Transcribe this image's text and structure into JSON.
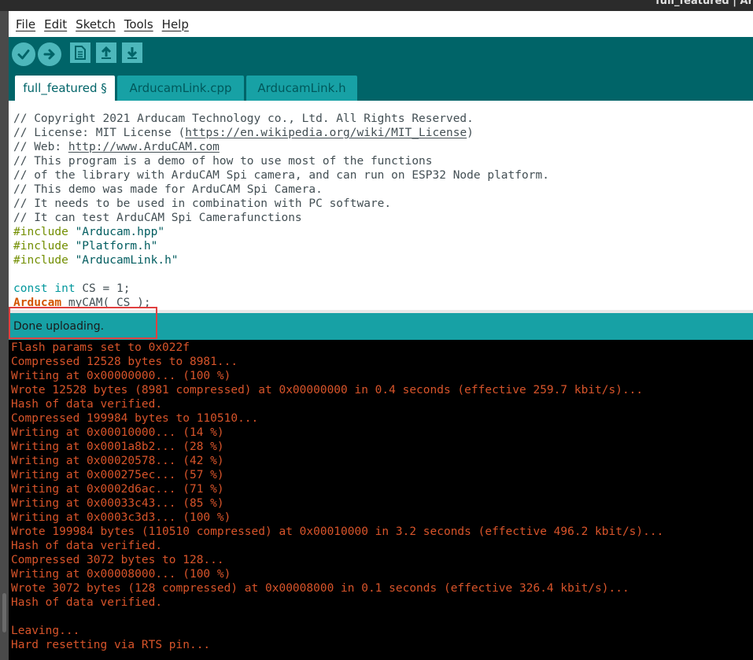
{
  "window": {
    "title": "full_featured | Ar"
  },
  "menu": [
    "File",
    "Edit",
    "Sketch",
    "Tools",
    "Help"
  ],
  "toolbar": {
    "buttons": [
      "verify-button",
      "upload-button",
      "new-button",
      "open-button",
      "save-button"
    ]
  },
  "tabs": [
    {
      "label": "full_featured §",
      "active": true
    },
    {
      "label": "ArducamLink.cpp",
      "active": false
    },
    {
      "label": "ArducamLink.h",
      "active": false
    }
  ],
  "editor": {
    "comments": [
      "// Copyright 2021 Arducam Technology co., Ltd. All Rights Reserved.",
      "// License: MIT License (",
      "https://en.wikipedia.org/wiki/MIT_License",
      ")",
      "// Web: ",
      "http://www.ArduCAM.com",
      "// This program is a demo of how to use most of the functions",
      "// of the library with ArduCAM Spi camera, and can run on ESP32 Node platform.",
      "// This demo was made for ArduCAM Spi Camera.",
      "// It needs to be used in combination with PC software.",
      "// It can test ArduCAM Spi Camerafunctions"
    ],
    "include_kw": "#include",
    "includes": [
      "\"Arducam.hpp\"",
      "\"Platform.h\"",
      "\"ArducamLink.h\""
    ],
    "const_kw": "const",
    "int_kw": "int",
    "cs_decl": " CS = 1;",
    "class_kw": "Arducam",
    "cam_decl": " myCAM( CS );"
  },
  "status": {
    "text": "Done uploading."
  },
  "console": [
    "Flash params set to 0x022f",
    "Compressed 12528 bytes to 8981...",
    "Writing at 0x00000000... (100 %)",
    "Wrote 12528 bytes (8981 compressed) at 0x00000000 in 0.4 seconds (effective 259.7 kbit/s)...",
    "Hash of data verified.",
    "Compressed 199984 bytes to 110510...",
    "Writing at 0x00010000... (14 %)",
    "Writing at 0x0001a8b2... (28 %)",
    "Writing at 0x00020578... (42 %)",
    "Writing at 0x000275ec... (57 %)",
    "Writing at 0x0002d6ac... (71 %)",
    "Writing at 0x00033c43... (85 %)",
    "Writing at 0x0003c3d3... (100 %)",
    "Wrote 199984 bytes (110510 compressed) at 0x00010000 in 3.2 seconds (effective 496.2 kbit/s)...",
    "Hash of data verified.",
    "Compressed 3072 bytes to 128...",
    "Writing at 0x00008000... (100 %)",
    "Wrote 3072 bytes (128 compressed) at 0x00008000 in 0.1 seconds (effective 326.4 kbit/s)...",
    "Hash of data verified.",
    "",
    "Leaving...",
    "Hard resetting via RTS pin..."
  ],
  "colors": {
    "toolbar": "#006468",
    "button": "#4db7bb",
    "status_bar": "#17a1a5",
    "console_text": "#d8542a",
    "highlight": "#e04040"
  }
}
